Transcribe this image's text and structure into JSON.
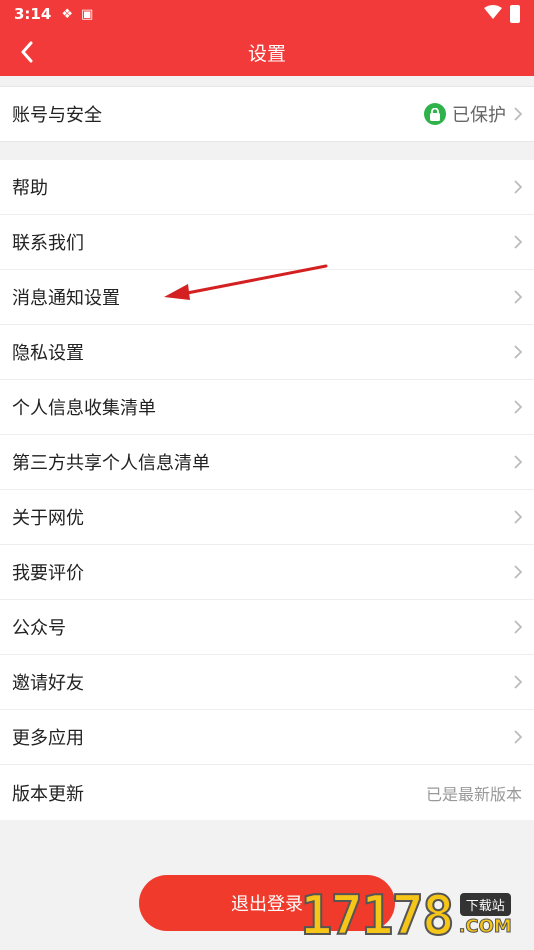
{
  "status_bar": {
    "time": "3:14"
  },
  "header": {
    "title": "设置"
  },
  "account": {
    "label": "账号与安全",
    "status": "已保护"
  },
  "items": [
    {
      "label": "帮助",
      "trail": ""
    },
    {
      "label": "联系我们",
      "trail": ""
    },
    {
      "label": "消息通知设置",
      "trail": ""
    },
    {
      "label": "隐私设置",
      "trail": ""
    },
    {
      "label": "个人信息收集清单",
      "trail": ""
    },
    {
      "label": "第三方共享个人信息清单",
      "trail": ""
    },
    {
      "label": "关于网优",
      "trail": ""
    },
    {
      "label": "我要评价",
      "trail": ""
    },
    {
      "label": "公众号",
      "trail": ""
    },
    {
      "label": "邀请好友",
      "trail": ""
    },
    {
      "label": "更多应用",
      "trail": ""
    },
    {
      "label": "版本更新",
      "trail": "已是最新版本"
    }
  ],
  "logout": {
    "label": "退出登录"
  },
  "watermark": {
    "number": "17178",
    "tag": "下载站",
    "domain": ".COM"
  },
  "colors": {
    "accent": "#f23a3a",
    "logout": "#f03a2c",
    "protected": "#2fb24a"
  }
}
